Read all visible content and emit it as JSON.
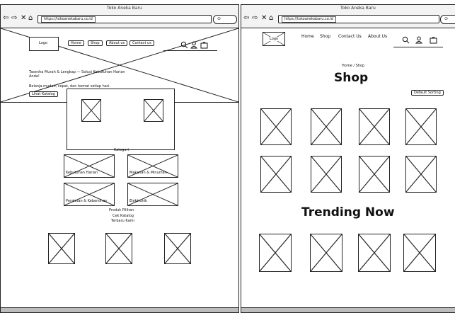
{
  "left": {
    "window_title": "Toko Aneka Baru",
    "url": "https://tokoanekabaru.co.id",
    "logo": "Logo",
    "nav": [
      "Home",
      "Shop",
      "About us",
      "Contact us"
    ],
    "hero_text": "Tasenha Murah & Lengkap — Solusi Kebutuhan Harian Anda!",
    "hero_sub": "Belanja mudah, cepat, dan hemat setiap hari.",
    "hero_button": "Lihat Katalog",
    "categories_title": "Kategori",
    "categories": [
      "Kebutuhan Harian",
      "Makanan & Minuman",
      "Peralatan & Kebersihan",
      "Elektronik"
    ],
    "featured_title": "Produk Pilihan",
    "featured_sub1": "Cek Katalog",
    "featured_sub2": "Terbaru Kami"
  },
  "right": {
    "window_title": "Toko Aneka Baru",
    "url": "https://tokoanekabaru.co.id",
    "logo": "Logo",
    "nav": [
      "Home",
      "Shop",
      "Contact Us",
      "About Us"
    ],
    "breadcrumb": "Home / Shop",
    "page_title": "Shop",
    "sort_button": "Default Sorting",
    "trending_title": "Trending Now"
  },
  "icons": [
    "back-arrow-icon",
    "forward-arrow-icon",
    "close-icon",
    "home-icon",
    "search-icon",
    "user-icon",
    "cart-icon"
  ]
}
